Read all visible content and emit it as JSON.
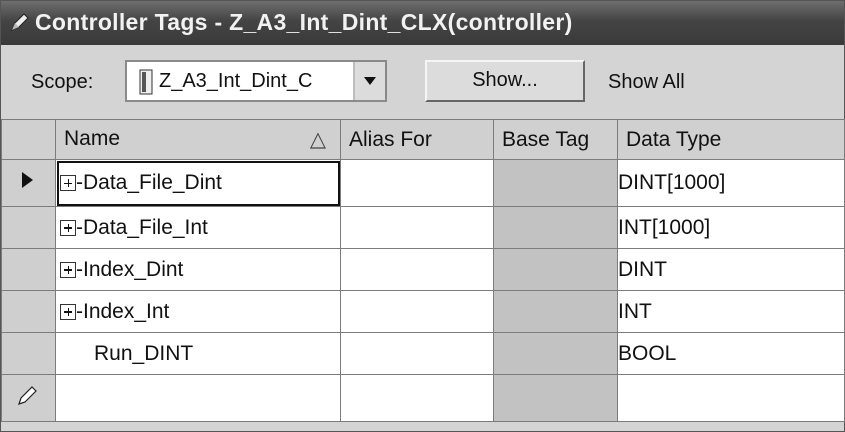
{
  "window": {
    "title": "Controller Tags - Z_A3_Int_Dint_CLX(controller)",
    "title_icon": "pencil-icon"
  },
  "scope": {
    "label": "Scope:",
    "value": "Z_A3_Int_Dint_C",
    "dropdown_icon": "chevron-down-icon",
    "show_button": "Show...",
    "show_filter": "Show All"
  },
  "columns": {
    "name": "Name",
    "name_sort": "△",
    "alias_for": "Alias For",
    "base_tag": "Base Tag",
    "data_type": "Data Type"
  },
  "rows": [
    {
      "name": "-Data_File_Dint",
      "expandable": true,
      "data_type": "DINT[1000]",
      "selected": true
    },
    {
      "name": "-Data_File_Int",
      "expandable": true,
      "data_type": "INT[1000]"
    },
    {
      "name": "-Index_Dint",
      "expandable": true,
      "data_type": "DINT"
    },
    {
      "name": "-Index_Int",
      "expandable": true,
      "data_type": "INT"
    },
    {
      "name": "Run_DINT",
      "expandable": false,
      "data_type": "BOOL"
    }
  ]
}
